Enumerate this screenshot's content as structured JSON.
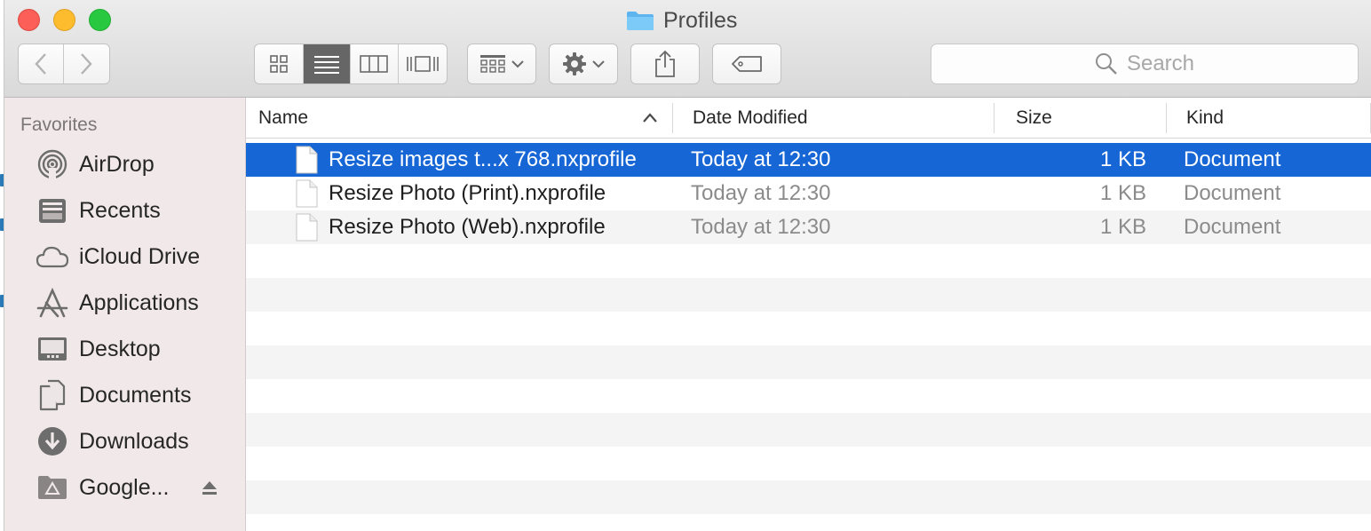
{
  "window": {
    "title": "Profiles"
  },
  "toolbar": {
    "back_icon": "chevron-left-icon",
    "forward_icon": "chevron-right-icon",
    "view_modes": [
      "icon-view",
      "list-view",
      "column-view",
      "cover-flow-view"
    ],
    "active_view": "list-view",
    "group_icon": "group-by-icon",
    "action_icon": "gear-icon",
    "share_icon": "share-icon",
    "tags_icon": "tag-icon",
    "search_placeholder": "Search"
  },
  "sidebar": {
    "header": "Favorites",
    "items": [
      {
        "label": "AirDrop",
        "icon": "airdrop-icon"
      },
      {
        "label": "Recents",
        "icon": "recents-icon"
      },
      {
        "label": "iCloud Drive",
        "icon": "cloud-icon"
      },
      {
        "label": "Applications",
        "icon": "applications-icon"
      },
      {
        "label": "Desktop",
        "icon": "desktop-icon"
      },
      {
        "label": "Documents",
        "icon": "documents-icon"
      },
      {
        "label": "Downloads",
        "icon": "downloads-icon"
      },
      {
        "label": "Google...",
        "icon": "google-drive-folder-icon"
      }
    ]
  },
  "columns": {
    "name": "Name",
    "date": "Date Modified",
    "size": "Size",
    "kind": "Kind"
  },
  "files": [
    {
      "name": "Resize images t...x 768.nxprofile",
      "date": "Today at 12:30",
      "size": "1 KB",
      "kind": "Document",
      "selected": true
    },
    {
      "name": "Resize Photo (Print).nxprofile",
      "date": "Today at 12:30",
      "size": "1 KB",
      "kind": "Document",
      "selected": false
    },
    {
      "name": "Resize Photo (Web).nxprofile",
      "date": "Today at 12:30",
      "size": "1 KB",
      "kind": "Document",
      "selected": false
    }
  ],
  "colors": {
    "selection": "#1666d6",
    "sidebar": "#f1e9e9",
    "folder": "#5db4ef"
  }
}
